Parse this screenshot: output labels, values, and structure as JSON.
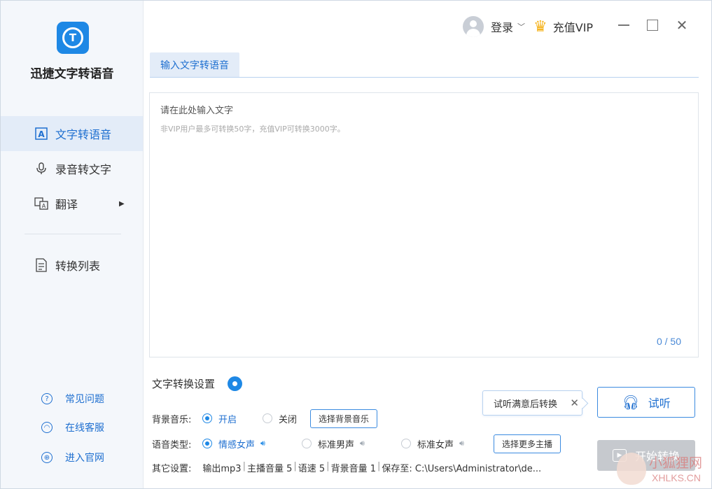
{
  "app": {
    "name": "迅捷文字转语音",
    "logo_glyph": "T"
  },
  "sidebar": {
    "items": [
      {
        "label": "文字转语音",
        "icon": "text-a-icon",
        "active": true
      },
      {
        "label": "录音转文字",
        "icon": "microphone-icon",
        "active": false
      },
      {
        "label": "翻译",
        "icon": "translate-icon",
        "active": false,
        "has_submenu": true
      }
    ],
    "items2": [
      {
        "label": "转换列表",
        "icon": "list-icon"
      }
    ],
    "help": [
      {
        "label": "常见问题",
        "icon": "question-icon"
      },
      {
        "label": "在线客服",
        "icon": "headset-icon"
      },
      {
        "label": "进入官网",
        "icon": "globe-icon"
      }
    ]
  },
  "titlebar": {
    "login": "登录",
    "vip": "充值VIP"
  },
  "tabs": [
    {
      "label": "输入文字转语音",
      "active": true
    }
  ],
  "editor": {
    "placeholder": "请在此处输入文字",
    "hint": "非VIP用户最多可转换50字，充值VIP可转换3000字。",
    "counter": "0 / 50"
  },
  "settings": {
    "title": "文字转换设置",
    "bg_music": {
      "label": "背景音乐:",
      "options": [
        {
          "label": "开启",
          "selected": true
        },
        {
          "label": "关闭",
          "selected": false
        }
      ],
      "button": "选择背景音乐"
    },
    "voice": {
      "label": "语音类型:",
      "options": [
        {
          "label": "情感女声",
          "selected": true
        },
        {
          "label": "标准男声",
          "selected": false
        },
        {
          "label": "标准女声",
          "selected": false
        }
      ],
      "button": "选择更多主播"
    },
    "other": {
      "label": "其它设置:",
      "format": "输出mp3",
      "host_volume": "主播音量 5",
      "speed": "语速 5",
      "bg_volume": "背景音量 1",
      "save_path": "保存至: C:\\Users\\Administrator\\de..."
    }
  },
  "actions": {
    "tip": "试听满意后转换",
    "listen": "试听",
    "start": "开始转换"
  },
  "watermark": {
    "text1": "小狐狸网",
    "text2": "XHLKS.CN"
  },
  "colors": {
    "accent": "#1e88e5",
    "accent_text": "#1e6fd0",
    "sidebar_bg": "#f4f7fb",
    "disabled": "#c6c9ce"
  }
}
